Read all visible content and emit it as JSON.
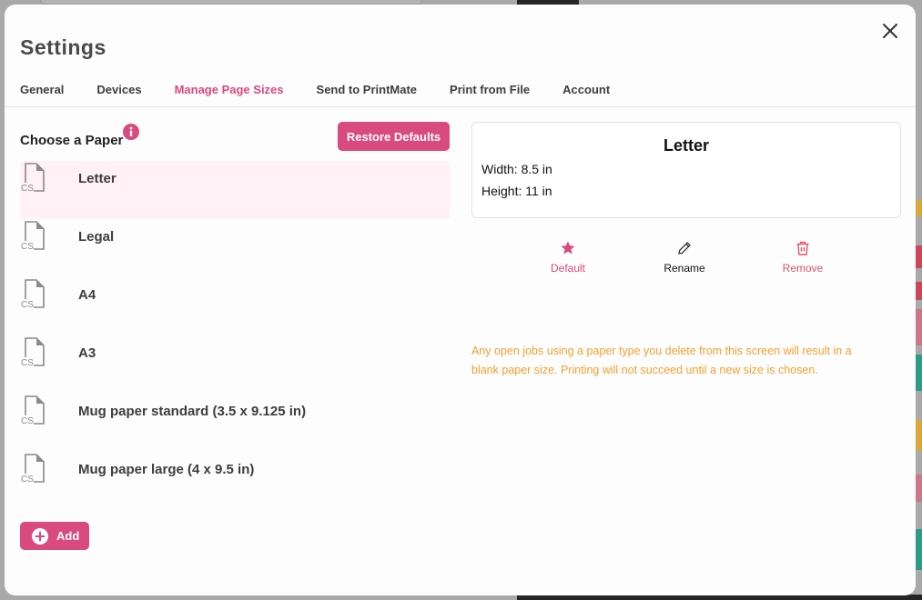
{
  "dialog": {
    "title": "Settings",
    "close_icon": "close-icon"
  },
  "tabs": [
    {
      "label": "General",
      "active": false
    },
    {
      "label": "Devices",
      "active": false
    },
    {
      "label": "Manage Page Sizes",
      "active": true
    },
    {
      "label": "Send to PrintMate",
      "active": false
    },
    {
      "label": "Print from File",
      "active": false
    },
    {
      "label": "Account",
      "active": false
    }
  ],
  "paper_list": {
    "title": "Choose a Paper",
    "info_icon": "info-icon",
    "restore_label": "Restore Defaults",
    "doc_icon_badge": "CS",
    "items": [
      {
        "label": "Letter",
        "selected": true
      },
      {
        "label": "Legal",
        "selected": false
      },
      {
        "label": "A4",
        "selected": false
      },
      {
        "label": "A3",
        "selected": false
      },
      {
        "label": "Mug paper standard (3.5 x 9.125 in)",
        "selected": false
      },
      {
        "label": "Mug paper large (4 x 9.5 in)",
        "selected": false
      }
    ],
    "add_label": "Add"
  },
  "detail": {
    "name": "Letter",
    "width_text": "Width: 8.5 in",
    "height_text": "Height: 11 in"
  },
  "actions": {
    "default_label": "Default",
    "rename_label": "Rename",
    "remove_label": "Remove"
  },
  "warning": "Any open jobs using a paper type you delete from this screen will result in a blank paper size. Printing will not succeed until a new size is chosen.",
  "colors": {
    "accent": "#d94a7e",
    "remove": "#e0566b",
    "warning": "#f4a130",
    "selected_row": "#fff1f5"
  }
}
